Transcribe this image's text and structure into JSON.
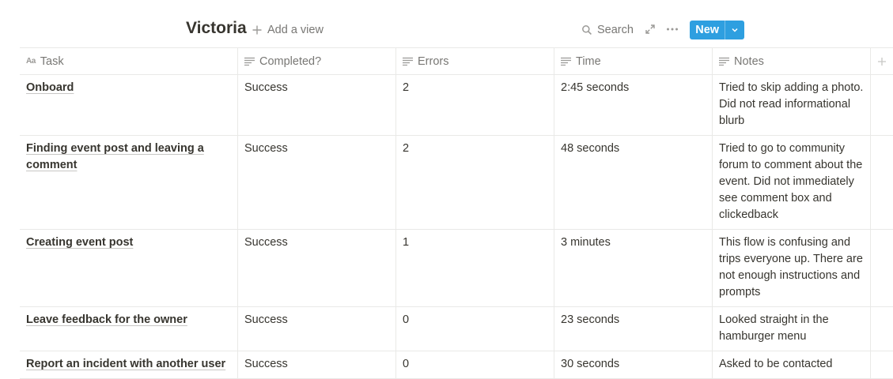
{
  "header": {
    "title": "Victoria",
    "add_view_label": "Add a view",
    "search_label": "Search",
    "new_label": "New"
  },
  "columns": [
    {
      "label": "Task",
      "icon": "title-aa-icon"
    },
    {
      "label": "Completed?",
      "icon": "text-lines-icon"
    },
    {
      "label": "Errors",
      "icon": "text-lines-icon"
    },
    {
      "label": "Time",
      "icon": "text-lines-icon"
    },
    {
      "label": "Notes",
      "icon": "text-lines-icon"
    }
  ],
  "rows": [
    {
      "task": "Onboard",
      "completed": "Success",
      "errors": "2",
      "time": "2:45 seconds",
      "notes": "Tried to skip adding a photo. Did not read informational blurb"
    },
    {
      "task": "Finding event post and leaving a comment",
      "completed": "Success",
      "errors": "2",
      "time": "48 seconds",
      "notes": "Tried to go to community forum to comment about the event. Did not immediately see comment box and clickedback"
    },
    {
      "task": "Creating event post",
      "completed": "Success",
      "errors": "1",
      "time": "3 minutes",
      "notes": "This flow is confusing and trips everyone up. There are not enough instructions and prompts"
    },
    {
      "task": "Leave feedback for the owner",
      "completed": "Success",
      "errors": "0",
      "time": "23 seconds",
      "notes": "Looked straight in the hamburger menu"
    },
    {
      "task": "Report an incident with another user",
      "completed": "Success",
      "errors": "0",
      "time": "30 seconds",
      "notes": "Asked to be contacted"
    }
  ],
  "colors": {
    "text": "#37352f",
    "muted": "#787774",
    "border": "#e9e9e7",
    "accent": "#2e9fe0"
  }
}
